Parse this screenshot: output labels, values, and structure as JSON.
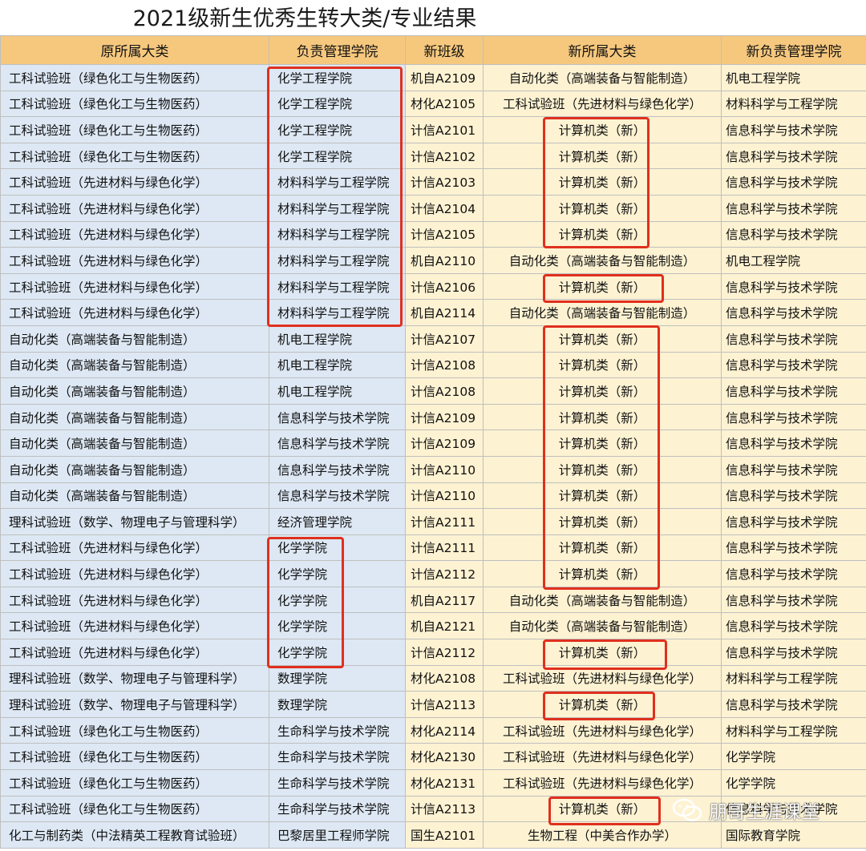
{
  "title": "2021级新生优秀生转大类/专业结果",
  "headers": [
    "原所属大类",
    "负责管理学院",
    "新班级",
    "新所属大类",
    "新负责管理学院"
  ],
  "rows": [
    [
      "工科试验班（绿色化工与生物医药）",
      "化学工程学院",
      "机自A2109",
      "自动化类（高端装备与智能制造）",
      "机电工程学院"
    ],
    [
      "工科试验班（绿色化工与生物医药）",
      "化学工程学院",
      "材化A2105",
      "工科试验班（先进材料与绿色化学）",
      "材料科学与工程学院"
    ],
    [
      "工科试验班（绿色化工与生物医药）",
      "化学工程学院",
      "计信A2101",
      "计算机类（新）",
      "信息科学与技术学院"
    ],
    [
      "工科试验班（绿色化工与生物医药）",
      "化学工程学院",
      "计信A2102",
      "计算机类（新）",
      "信息科学与技术学院"
    ],
    [
      "工科试验班（先进材料与绿色化学）",
      "材料科学与工程学院",
      "计信A2103",
      "计算机类（新）",
      "信息科学与技术学院"
    ],
    [
      "工科试验班（先进材料与绿色化学）",
      "材料科学与工程学院",
      "计信A2104",
      "计算机类（新）",
      "信息科学与技术学院"
    ],
    [
      "工科试验班（先进材料与绿色化学）",
      "材料科学与工程学院",
      "计信A2105",
      "计算机类（新）",
      "信息科学与技术学院"
    ],
    [
      "工科试验班（先进材料与绿色化学）",
      "材料科学与工程学院",
      "机自A2110",
      "自动化类（高端装备与智能制造）",
      "机电工程学院"
    ],
    [
      "工科试验班（先进材料与绿色化学）",
      "材料科学与工程学院",
      "计信A2106",
      "计算机类（新）",
      "信息科学与技术学院"
    ],
    [
      "工科试验班（先进材料与绿色化学）",
      "材料科学与工程学院",
      "机自A2114",
      "自动化类（高端装备与智能制造）",
      "信息科学与技术学院"
    ],
    [
      "自动化类（高端装备与智能制造）",
      "机电工程学院",
      "计信A2107",
      "计算机类（新）",
      "信息科学与技术学院"
    ],
    [
      "自动化类（高端装备与智能制造）",
      "机电工程学院",
      "计信A2108",
      "计算机类（新）",
      "信息科学与技术学院"
    ],
    [
      "自动化类（高端装备与智能制造）",
      "机电工程学院",
      "计信A2108",
      "计算机类（新）",
      "信息科学与技术学院"
    ],
    [
      "自动化类（高端装备与智能制造）",
      "信息科学与技术学院",
      "计信A2109",
      "计算机类（新）",
      "信息科学与技术学院"
    ],
    [
      "自动化类（高端装备与智能制造）",
      "信息科学与技术学院",
      "计信A2109",
      "计算机类（新）",
      "信息科学与技术学院"
    ],
    [
      "自动化类（高端装备与智能制造）",
      "信息科学与技术学院",
      "计信A2110",
      "计算机类（新）",
      "信息科学与技术学院"
    ],
    [
      "自动化类（高端装备与智能制造）",
      "信息科学与技术学院",
      "计信A2110",
      "计算机类（新）",
      "信息科学与技术学院"
    ],
    [
      "理科试验班（数学、物理电子与管理科学）",
      "经济管理学院",
      "计信A2111",
      "计算机类（新）",
      "信息科学与技术学院"
    ],
    [
      "工科试验班（先进材料与绿色化学）",
      "化学学院",
      "计信A2111",
      "计算机类（新）",
      "信息科学与技术学院"
    ],
    [
      "工科试验班（先进材料与绿色化学）",
      "化学学院",
      "计信A2112",
      "计算机类（新）",
      "信息科学与技术学院"
    ],
    [
      "工科试验班（先进材料与绿色化学）",
      "化学学院",
      "机自A2117",
      "自动化类（高端装备与智能制造）",
      "信息科学与技术学院"
    ],
    [
      "工科试验班（先进材料与绿色化学）",
      "化学学院",
      "机自A2121",
      "自动化类（高端装备与智能制造）",
      "信息科学与技术学院"
    ],
    [
      "工科试验班（先进材料与绿色化学）",
      "化学学院",
      "计信A2112",
      "计算机类（新）",
      "信息科学与技术学院"
    ],
    [
      "理科试验班（数学、物理电子与管理科学）",
      "数理学院",
      "材化A2108",
      "工科试验班（先进材料与绿色化学）",
      "材料科学与工程学院"
    ],
    [
      "理科试验班（数学、物理电子与管理科学）",
      "数理学院",
      "计信A2113",
      "计算机类（新）",
      "信息科学与技术学院"
    ],
    [
      "工科试验班（绿色化工与生物医药）",
      "生命科学与技术学院",
      "材化A2114",
      "工科试验班（先进材料与绿色化学）",
      "材料科学与工程学院"
    ],
    [
      "工科试验班（绿色化工与生物医药）",
      "生命科学与技术学院",
      "材化A2130",
      "工科试验班（先进材料与绿色化学）",
      "化学学院"
    ],
    [
      "工科试验班（绿色化工与生物医药）",
      "生命科学与技术学院",
      "材化A2131",
      "工科试验班（先进材料与绿色化学）",
      "化学学院"
    ],
    [
      "工科试验班（绿色化工与生物医药）",
      "生命科学与技术学院",
      "计信A2113",
      "计算机类（新）",
      "信息科学与技术学院"
    ],
    [
      "化工与制药类（中法精英工程教育试验班）",
      "巴黎居里工程师学院",
      "国生A2101",
      "生物工程（中美合作办学）",
      "国际教育学院"
    ]
  ],
  "watermark": "朋哥生涯课堂",
  "highlight_color": "#e0301e"
}
